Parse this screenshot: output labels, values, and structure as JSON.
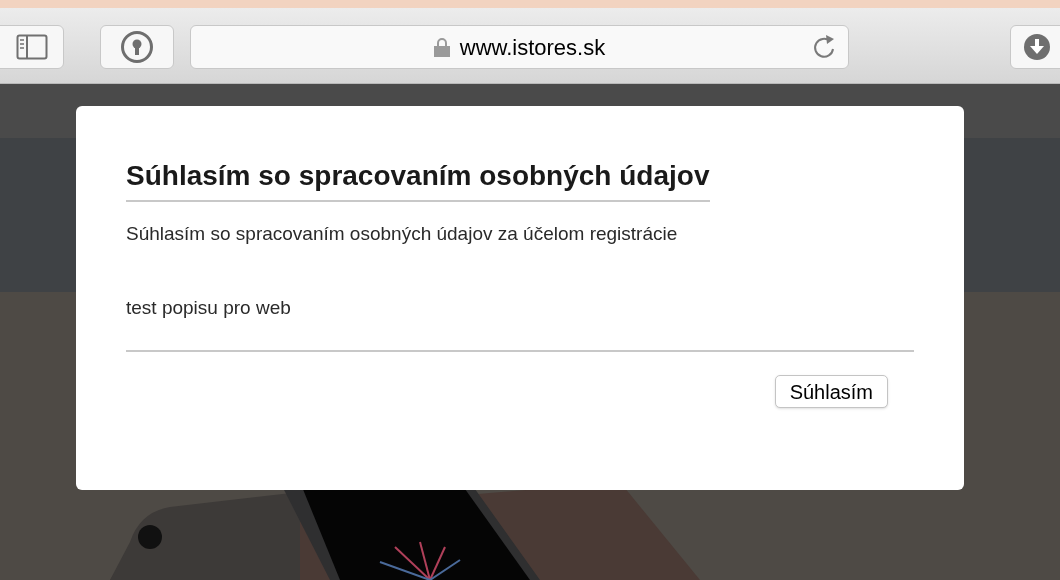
{
  "browser": {
    "url": "www.istores.sk",
    "secure": true
  },
  "dialog": {
    "title": "Súhlasím so spracovaním osobných údajov",
    "paragraphs": [
      "Súhlasím so spracovaním osobných údajov za účelom registrácie",
      "test popisu pro web"
    ],
    "button": "Súhlasím"
  }
}
